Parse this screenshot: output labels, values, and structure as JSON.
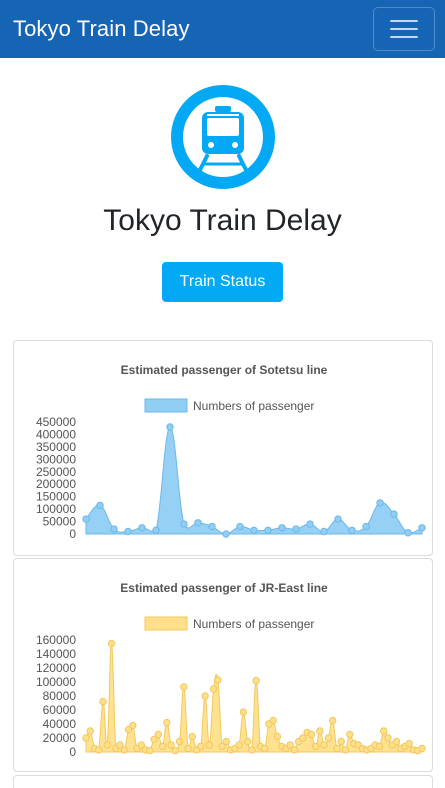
{
  "navbar": {
    "brand": "Tokyo Train Delay"
  },
  "hero": {
    "title": "Tokyo Train Delay",
    "button_label": "Train Status"
  },
  "icons": {
    "logo": "train-icon",
    "menu": "hamburger-menu-icon"
  },
  "colors": {
    "navbar": "#1565b4",
    "button": "#03a9f4",
    "logo": "#03a9f4"
  },
  "chart_data": [
    {
      "type": "area",
      "title": "Estimated passenger of Sotetsu line",
      "legend": "Numbers of passenger",
      "legend_position": "top",
      "ylim": [
        0,
        450000
      ],
      "yticks": [
        0,
        50000,
        100000,
        150000,
        200000,
        250000,
        300000,
        350000,
        400000,
        450000
      ],
      "grid": false,
      "fill": "#90cef4",
      "stroke": "#6cb8e8",
      "values": [
        60000,
        115000,
        20000,
        10000,
        25000,
        15000,
        430000,
        40000,
        45000,
        30000,
        0,
        30000,
        15000,
        15000,
        25000,
        20000,
        40000,
        10000,
        60000,
        15000,
        30000,
        125000,
        80000,
        5000,
        25000
      ]
    },
    {
      "type": "area",
      "title": "Estimated passenger of JR-East line",
      "legend": "Numbers of passenger",
      "legend_position": "top",
      "ylim": [
        0,
        160000
      ],
      "yticks": [
        0,
        20000,
        40000,
        60000,
        80000,
        100000,
        120000,
        140000,
        160000
      ],
      "grid": false,
      "fill": "#ffe08a",
      "stroke": "#f1c860",
      "values": [
        20000,
        30000,
        5000,
        3000,
        72000,
        10000,
        155000,
        5000,
        10000,
        3000,
        32000,
        38000,
        5000,
        10000,
        3000,
        2000,
        18000,
        25000,
        8000,
        42000,
        10000,
        2000,
        15000,
        93000,
        5000,
        22000,
        3000,
        8000,
        80000,
        10000,
        90000,
        103000,
        8000,
        15000,
        3000,
        5000,
        10000,
        57000,
        15000,
        3000,
        102000,
        8000,
        5000,
        40000,
        45000,
        22000,
        8000,
        5000,
        10000,
        3000,
        15000,
        20000,
        28000,
        25000,
        8000,
        30000,
        10000,
        20000,
        45000,
        5000,
        15000,
        3000,
        25000,
        12000,
        10000,
        5000,
        3000,
        5000,
        10000,
        8000,
        30000,
        20000,
        10000,
        15000,
        5000,
        8000,
        12000,
        3000,
        2000,
        5000
      ]
    }
  ]
}
